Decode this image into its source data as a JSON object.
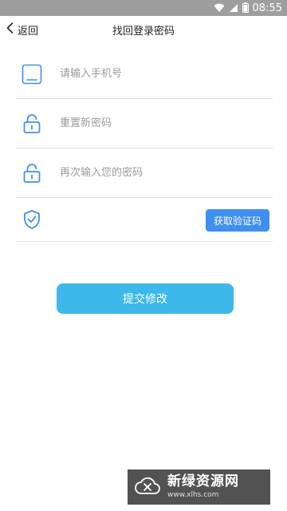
{
  "status_bar": {
    "time": "08:55",
    "background": "#9e9e9e",
    "icons": [
      "wifi-icon",
      "signal-icon",
      "battery-icon"
    ]
  },
  "nav": {
    "back_label": "返回",
    "title": "找回登录密码"
  },
  "form": {
    "phone_placeholder": "请输入手机号",
    "new_password_placeholder": "重置新密码",
    "confirm_password_placeholder": "再次输入您的密码",
    "get_code_label": "获取验证码",
    "icons": [
      "phone-icon",
      "lock-icon",
      "lock-icon",
      "shield-check-icon"
    ],
    "icon_color": "#3f8ff0"
  },
  "submit": {
    "label": "提交修改",
    "color": "#3cb8ea"
  },
  "watermark": {
    "main": "新绿资源网",
    "url": "www.xlhs.com"
  }
}
